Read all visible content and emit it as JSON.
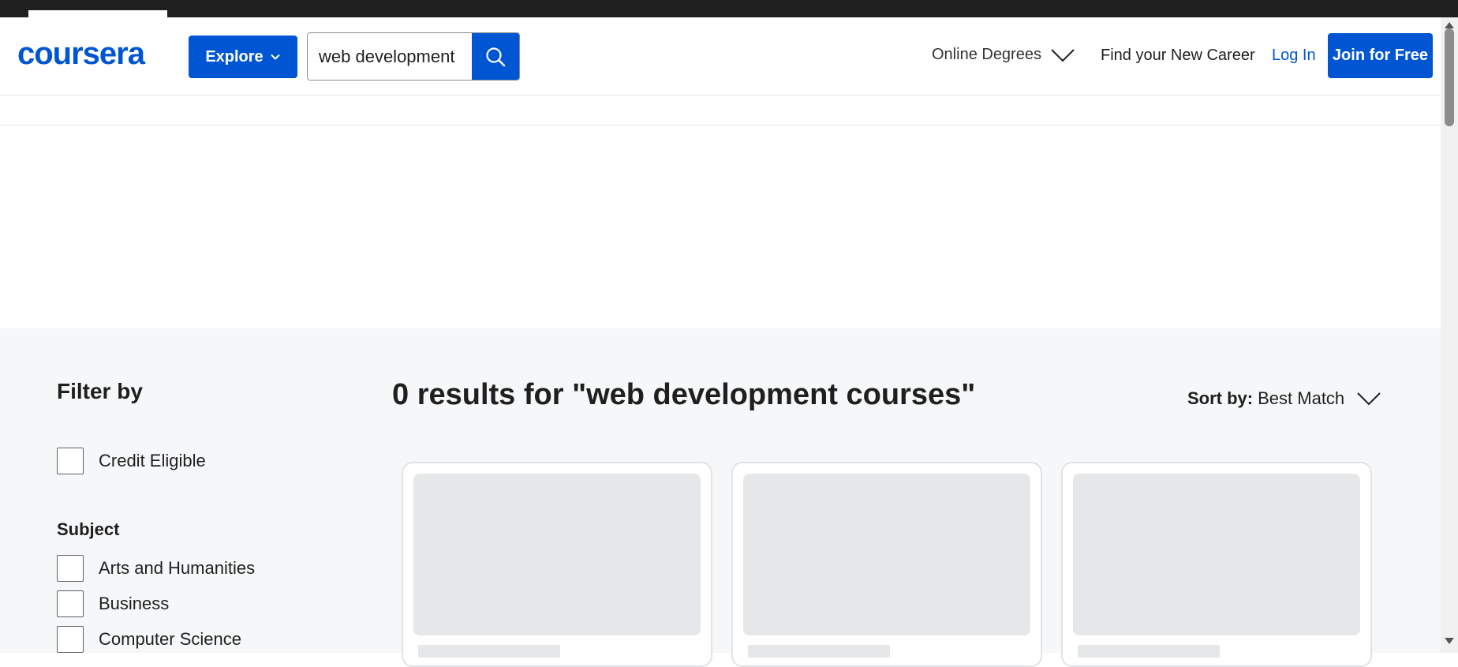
{
  "header": {
    "logo": "coursera",
    "explore_label": "Explore",
    "search_value": "web development",
    "nav": {
      "online_degrees": "Online Degrees",
      "find_career": "Find your New Career",
      "login": "Log In",
      "join": "Join for Free"
    }
  },
  "filters": {
    "title": "Filter by",
    "credit_eligible": "Credit Eligible",
    "subject_title": "Subject",
    "subjects": [
      "Arts and Humanities",
      "Business",
      "Computer Science"
    ]
  },
  "results": {
    "title": "0 results for \"web development courses\"",
    "sort_label": "Sort by:",
    "sort_value": "Best Match"
  },
  "colors": {
    "brand": "#0056d2",
    "background_main": "#f5f7f8",
    "skeleton": "#e5e7e8"
  },
  "icons": [
    "search-icon",
    "chevron-down-icon"
  ]
}
